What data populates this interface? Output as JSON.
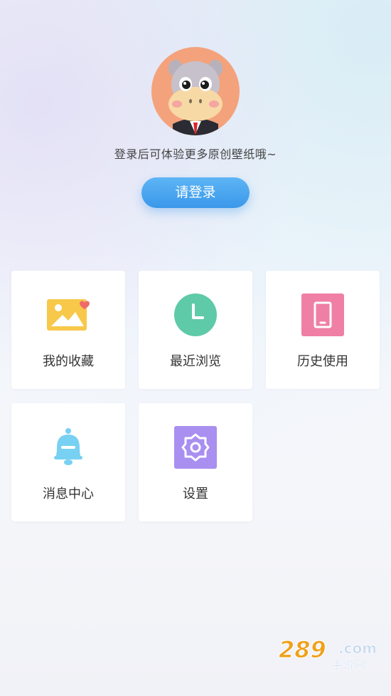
{
  "profile": {
    "subtitle": "登录后可体验更多原创壁纸哦~",
    "login_label": "请登录"
  },
  "menu": [
    {
      "label": "我的收藏",
      "icon": "image-heart-icon",
      "color": "#f7c84a"
    },
    {
      "label": "最近浏览",
      "icon": "clock-icon",
      "color": "#5fcaa7"
    },
    {
      "label": "历史使用",
      "icon": "phone-icon",
      "color": "#ef7fa4"
    },
    {
      "label": "消息中心",
      "icon": "bell-icon",
      "color": "#78d1f2"
    },
    {
      "label": "设置",
      "icon": "gear-icon",
      "color": "#a98ff0"
    }
  ],
  "watermark": {
    "brand": "289",
    "suffix": ".com",
    "sub": "手游网"
  }
}
